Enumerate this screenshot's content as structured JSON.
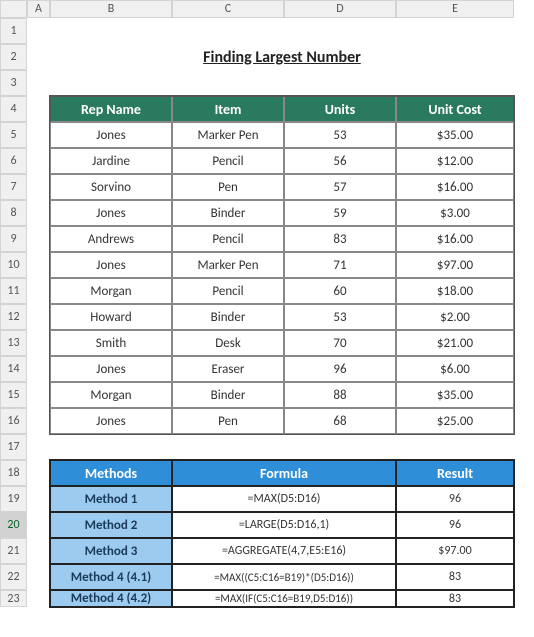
{
  "columns": [
    "A",
    "B",
    "C",
    "D",
    "E"
  ],
  "row_count": 23,
  "active_row": 20,
  "title": "Finding Largest Number",
  "table1": {
    "headers": [
      "Rep Name",
      "Item",
      "Units",
      "Unit Cost"
    ],
    "rows": [
      {
        "rep": "Jones",
        "item": "Marker Pen",
        "units": "53",
        "cost": "$35.00"
      },
      {
        "rep": "Jardine",
        "item": "Pencil",
        "units": "56",
        "cost": "$12.00"
      },
      {
        "rep": "Sorvino",
        "item": "Pen",
        "units": "57",
        "cost": "$16.00"
      },
      {
        "rep": "Jones",
        "item": "Binder",
        "units": "59",
        "cost": "$3.00"
      },
      {
        "rep": "Andrews",
        "item": "Pencil",
        "units": "83",
        "cost": "$16.00"
      },
      {
        "rep": "Jones",
        "item": "Marker Pen",
        "units": "71",
        "cost": "$97.00"
      },
      {
        "rep": "Morgan",
        "item": "Pencil",
        "units": "60",
        "cost": "$18.00"
      },
      {
        "rep": "Howard",
        "item": "Binder",
        "units": "53",
        "cost": "$2.00"
      },
      {
        "rep": "Smith",
        "item": "Desk",
        "units": "70",
        "cost": "$21.00"
      },
      {
        "rep": "Jones",
        "item": "Eraser",
        "units": "96",
        "cost": "$6.00"
      },
      {
        "rep": "Morgan",
        "item": "Binder",
        "units": "88",
        "cost": "$35.00"
      },
      {
        "rep": "Jones",
        "item": "Pen",
        "units": "68",
        "cost": "$25.00"
      }
    ]
  },
  "table2": {
    "headers": {
      "methods": "Methods",
      "formula": "Formula",
      "result": "Result"
    },
    "rows": [
      {
        "method": "Method 1",
        "formula": "=MAX(D5:D16)",
        "result": "96"
      },
      {
        "method": "Method 2",
        "formula": "=LARGE(D5:D16,1)",
        "result": "96"
      },
      {
        "method": "Method 3",
        "formula": "=AGGREGATE(4,7,E5:E16)",
        "result": "$97.00"
      },
      {
        "method": "Method 4 (4.1)",
        "formula": "=MAX((C5:C16=B19)*(D5:D16))",
        "result": "83"
      },
      {
        "method": "Method 4 (4.2)",
        "formula": "=MAX(IF(C5:C16=B19,D5:D16))",
        "result": "83"
      }
    ]
  },
  "chart_data": {
    "type": "table",
    "title": "Finding Largest Number",
    "tables": [
      {
        "name": "data",
        "columns": [
          "Rep Name",
          "Item",
          "Units",
          "Unit Cost"
        ],
        "rows": [
          [
            "Jones",
            "Marker Pen",
            53,
            35.0
          ],
          [
            "Jardine",
            "Pencil",
            56,
            12.0
          ],
          [
            "Sorvino",
            "Pen",
            57,
            16.0
          ],
          [
            "Jones",
            "Binder",
            59,
            3.0
          ],
          [
            "Andrews",
            "Pencil",
            83,
            16.0
          ],
          [
            "Jones",
            "Marker Pen",
            71,
            97.0
          ],
          [
            "Morgan",
            "Pencil",
            60,
            18.0
          ],
          [
            "Howard",
            "Binder",
            53,
            2.0
          ],
          [
            "Smith",
            "Desk",
            70,
            21.0
          ],
          [
            "Jones",
            "Eraser",
            96,
            6.0
          ],
          [
            "Morgan",
            "Binder",
            88,
            35.0
          ],
          [
            "Jones",
            "Pen",
            68,
            25.0
          ]
        ]
      },
      {
        "name": "methods",
        "columns": [
          "Methods",
          "Formula",
          "Result"
        ],
        "rows": [
          [
            "Method 1",
            "=MAX(D5:D16)",
            96
          ],
          [
            "Method 2",
            "=LARGE(D5:D16,1)",
            96
          ],
          [
            "Method 3",
            "=AGGREGATE(4,7,E5:E16)",
            97.0
          ],
          [
            "Method 4 (4.1)",
            "=MAX((C5:C16=B19)*(D5:D16))",
            83
          ],
          [
            "Method 4 (4.2)",
            "=MAX(IF(C5:C16=B19,D5:D16))",
            83
          ]
        ]
      }
    ]
  }
}
